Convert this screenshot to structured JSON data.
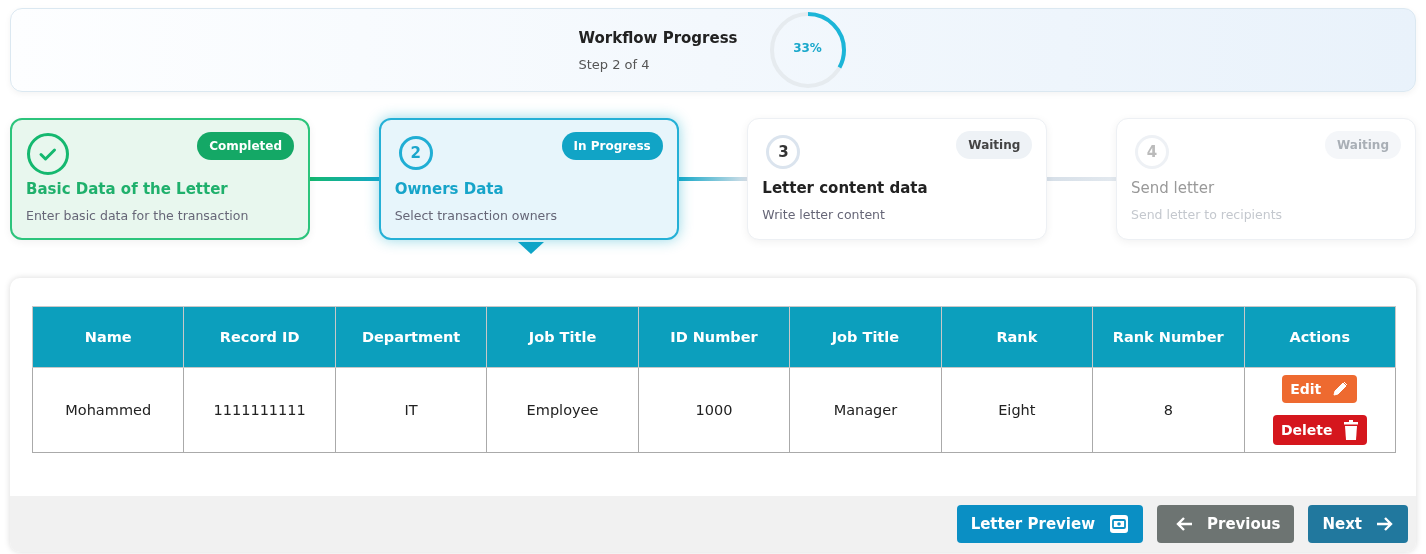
{
  "progress": {
    "title": "Workflow Progress",
    "subtitle": "Step 2 of 4",
    "percent": "33%",
    "level": 0.33
  },
  "steps": [
    {
      "kind": "completed",
      "badge": "Completed",
      "title": "Basic Data of the Letter",
      "description": "Enter basic data for the transaction"
    },
    {
      "kind": "in_progress",
      "number": "2",
      "badge": "In Progress",
      "title": "Owners Data",
      "description": "Select transaction owners",
      "selected": true
    },
    {
      "kind": "waiting",
      "number": "3",
      "badge": "Waiting",
      "title": "Letter content data",
      "description": "Write letter content",
      "selected": false
    },
    {
      "kind": "disabled",
      "number": "4",
      "badge": "Waiting",
      "title": "Send letter",
      "description": "Send letter to recipients",
      "selected": false
    }
  ],
  "table": {
    "columns": [
      "Name",
      "Record ID",
      "Department",
      "Job Title",
      "ID Number",
      "Job Title",
      "Rank",
      "Rank Number",
      "Actions"
    ],
    "rows": [
      {
        "cells": [
          "Mohammed",
          "1111111111",
          "IT",
          "Employee",
          "1000",
          "Manager",
          "Eight",
          "8"
        ],
        "actions": [
          {
            "kind": "edit",
            "label": "Edit"
          },
          {
            "kind": "delete",
            "label": "Delete"
          }
        ]
      }
    ]
  },
  "footer": {
    "buttons": [
      {
        "kind": "preview",
        "label": "Letter Preview"
      },
      {
        "kind": "previous",
        "label": "Previous"
      },
      {
        "kind": "next",
        "label": "Next"
      }
    ]
  }
}
